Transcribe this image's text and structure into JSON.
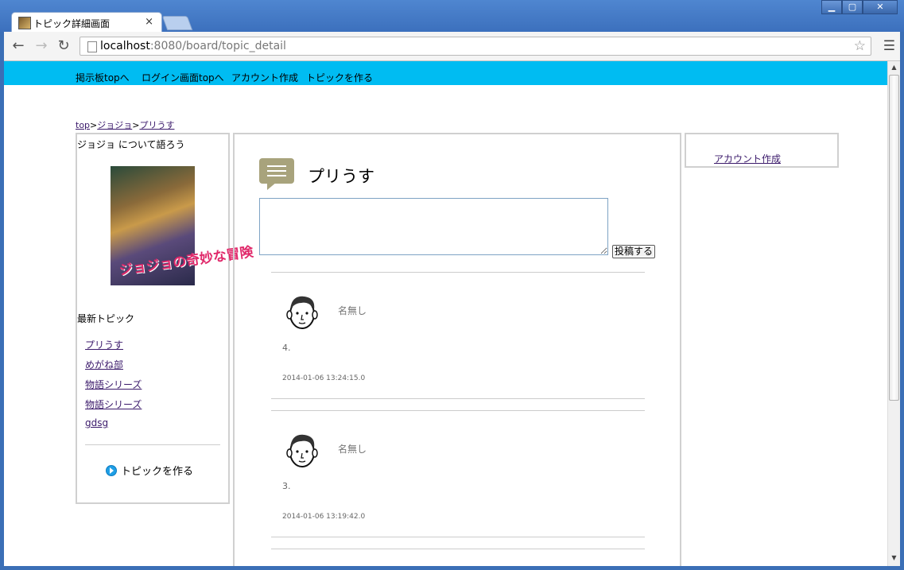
{
  "browser": {
    "tab_title": "トピック詳細画面",
    "tab_close": "×",
    "url_host": "localhost",
    "url_path": ":8080/board/topic_detail"
  },
  "site_nav": {
    "items": [
      {
        "label": "掲示板topへ"
      },
      {
        "label": "ログイン画面topへ"
      },
      {
        "label": "アカウント作成"
      },
      {
        "label": "トピックを作る"
      }
    ]
  },
  "breadcrumb": {
    "items": [
      "top",
      "ジョジョ",
      "プリうす"
    ],
    "separator": ">"
  },
  "left_panel": {
    "category_heading": "ジョジョ について語ろう",
    "cover_logo": "ジョジョの奇妙な冒険",
    "latest_heading": "最新トピック",
    "latest_topics": [
      "プリうす",
      "めがね部",
      "物語シリーズ",
      "物語シリーズ",
      "gdsg"
    ],
    "create_topic_label": "トピックを作る"
  },
  "main": {
    "topic_title": "プリうす",
    "post_button_label": "投稿する",
    "comments": [
      {
        "name": "名無し",
        "number": "4.",
        "datetime": "2014-01-06 13:24:15.0"
      },
      {
        "name": "名無し",
        "number": "3.",
        "datetime": "2014-01-06 13:19:42.0"
      }
    ]
  },
  "right_panel": {
    "account_link": "アカウント作成"
  },
  "colors": {
    "nav_bar": "#00bcf2",
    "link": "#3b1a6b",
    "chrome_frame": "#3b6fb6",
    "bubble_icon": "#a8a37c"
  }
}
